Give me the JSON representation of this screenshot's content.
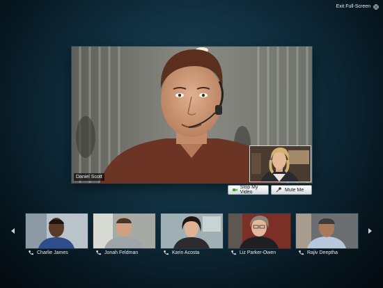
{
  "window": {
    "exit_fullscreen_label": "Exit Full-Screen",
    "exit_fullscreen_icon": "fullscreen-exit-icon"
  },
  "main_video": {
    "speaker_name": "Daniel Scott",
    "self_view": true
  },
  "controls": {
    "stop_video_label": "Stop My Video",
    "stop_video_icon": "video-camera-icon",
    "mute_label": "Mute Me",
    "mute_icon": "microphone-icon"
  },
  "filmstrip": {
    "prev_icon": "chevron-left-icon",
    "next_icon": "chevron-right-icon",
    "participants": [
      {
        "name": "Charlie James",
        "icon": "phone-icon"
      },
      {
        "name": "Jonah Feldman",
        "icon": "phone-icon"
      },
      {
        "name": "Karin Acosta",
        "icon": "phone-icon"
      },
      {
        "name": "Liz Parker-Owen",
        "icon": "phone-icon"
      },
      {
        "name": "Rajiv Deeptha",
        "icon": "phone-icon"
      }
    ]
  },
  "colors": {
    "background": "#0f2c3b",
    "button_top": "#ffffff",
    "button_bottom": "#d4d9dc",
    "camera_green": "#3aa23a"
  }
}
